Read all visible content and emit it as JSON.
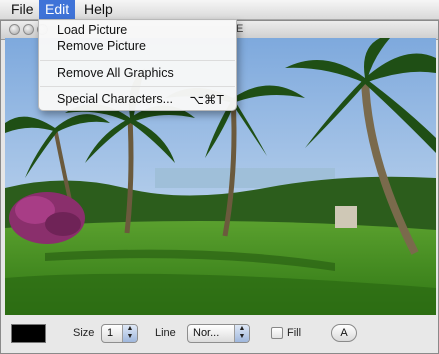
{
  "menubar": {
    "items": [
      {
        "label": "File"
      },
      {
        "label": "Edit"
      },
      {
        "label": "Help"
      }
    ]
  },
  "edit_menu": {
    "items": [
      {
        "label": "Load Picture"
      },
      {
        "label": "Remove Picture"
      },
      {
        "label": "Remove All Graphics"
      },
      {
        "label": "Special Characters...",
        "shortcut": "⌥⌘T"
      }
    ]
  },
  "window": {
    "title_fragment": "E"
  },
  "toolbar": {
    "color_swatch": "#000000",
    "size_label": "Size",
    "size_value": "1",
    "line_label": "Line",
    "line_value": "Nor...",
    "fill_label": "Fill",
    "fill_checked": false,
    "a_button_label": "A"
  },
  "colors": {
    "menu_highlight": "#3f73d8",
    "lawn": "#3f8f1e",
    "sky": "#a9c7e8"
  }
}
